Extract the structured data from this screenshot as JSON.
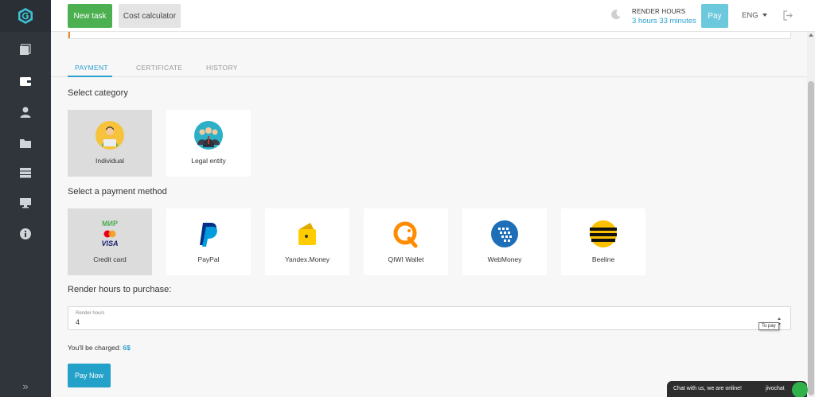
{
  "toolbar": {
    "new_task_label": "New task",
    "cost_calculator_label": "Cost calculator",
    "render_hours_label": "RENDER HOURS",
    "render_hours_value": "3 hours 33 minutes",
    "pay_label": "Pay",
    "language": "ENG"
  },
  "sidebar": {
    "items": [
      {
        "icon": "dashboard-icon"
      },
      {
        "icon": "wallet-icon"
      },
      {
        "icon": "user-icon"
      },
      {
        "icon": "folder-icon"
      },
      {
        "icon": "server-icon"
      },
      {
        "icon": "monitor-icon"
      },
      {
        "icon": "info-icon"
      }
    ],
    "collapse_label": "»"
  },
  "tabs": [
    {
      "label": "PAYMENT",
      "active": true
    },
    {
      "label": "CERTIFICATE",
      "active": false
    },
    {
      "label": "HISTORY",
      "active": false
    }
  ],
  "category": {
    "title": "Select category",
    "options": [
      {
        "label": "Individual",
        "selected": true
      },
      {
        "label": "Legal entity",
        "selected": false
      }
    ]
  },
  "payment": {
    "title": "Select a payment method",
    "mir_text": "МИР",
    "visa_text": "VISA",
    "methods": [
      {
        "label": "Credit card",
        "selected": true
      },
      {
        "label": "PayPal",
        "selected": false
      },
      {
        "label": "Yandex.Money",
        "selected": false
      },
      {
        "label": "QIWI Wallet",
        "selected": false
      },
      {
        "label": "WebMoney",
        "selected": false
      },
      {
        "label": "Beeline",
        "selected": false
      }
    ]
  },
  "purchase": {
    "title": "Render hours to purchase:",
    "field_label": "Render hours",
    "field_value": "4",
    "tooltip": "To pay",
    "charged_prefix": "You'll be charged:",
    "charged_amount": "6$",
    "pay_now_label": "Pay Now"
  },
  "chat": {
    "message": "Chat with us, we are online!",
    "brand": "jivochat"
  },
  "colors": {
    "accent": "#2a9fd0",
    "new_task_green": "#4caf50",
    "pay_button": "#6cc8dc",
    "sidebar_bg": "#2f353b"
  }
}
